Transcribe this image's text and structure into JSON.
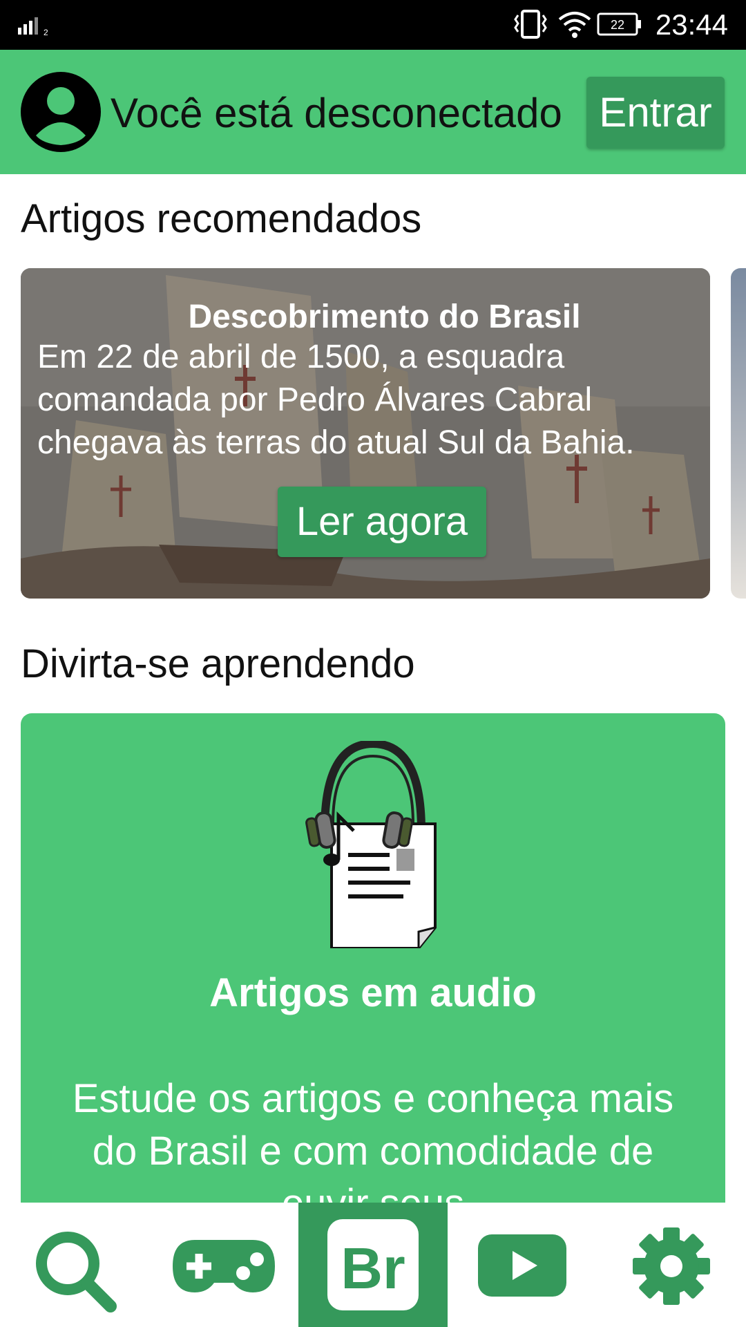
{
  "status_bar": {
    "time": "23:44",
    "battery_level": "22",
    "signal_label": "2"
  },
  "login": {
    "status_text": "Você está desconectado",
    "login_button": "Entrar"
  },
  "recommended": {
    "section_title": "Artigos recomendados",
    "card": {
      "title": "Descobrimento do Brasil",
      "text": "Em 22 de abril de 1500, a esquadra comandada por Pedro Álvares Cabral chegava às terras do atual Sul da Bahia.",
      "button": "Ler agora"
    }
  },
  "fun": {
    "section_title": "Divirta-se aprendendo",
    "card": {
      "title": "Artigos em audio",
      "description": "Estude os artigos e conheça mais do Brasil e com comodidade de ouvir seus"
    }
  },
  "bottom_nav": {
    "home_label": "Br",
    "items": [
      "search-icon",
      "gamepad-icon",
      "home-br-icon",
      "video-play-icon",
      "gear-icon"
    ]
  },
  "colors": {
    "primary_green": "#4cc677",
    "dark_green": "#35995b",
    "status_bar": "#000000"
  }
}
